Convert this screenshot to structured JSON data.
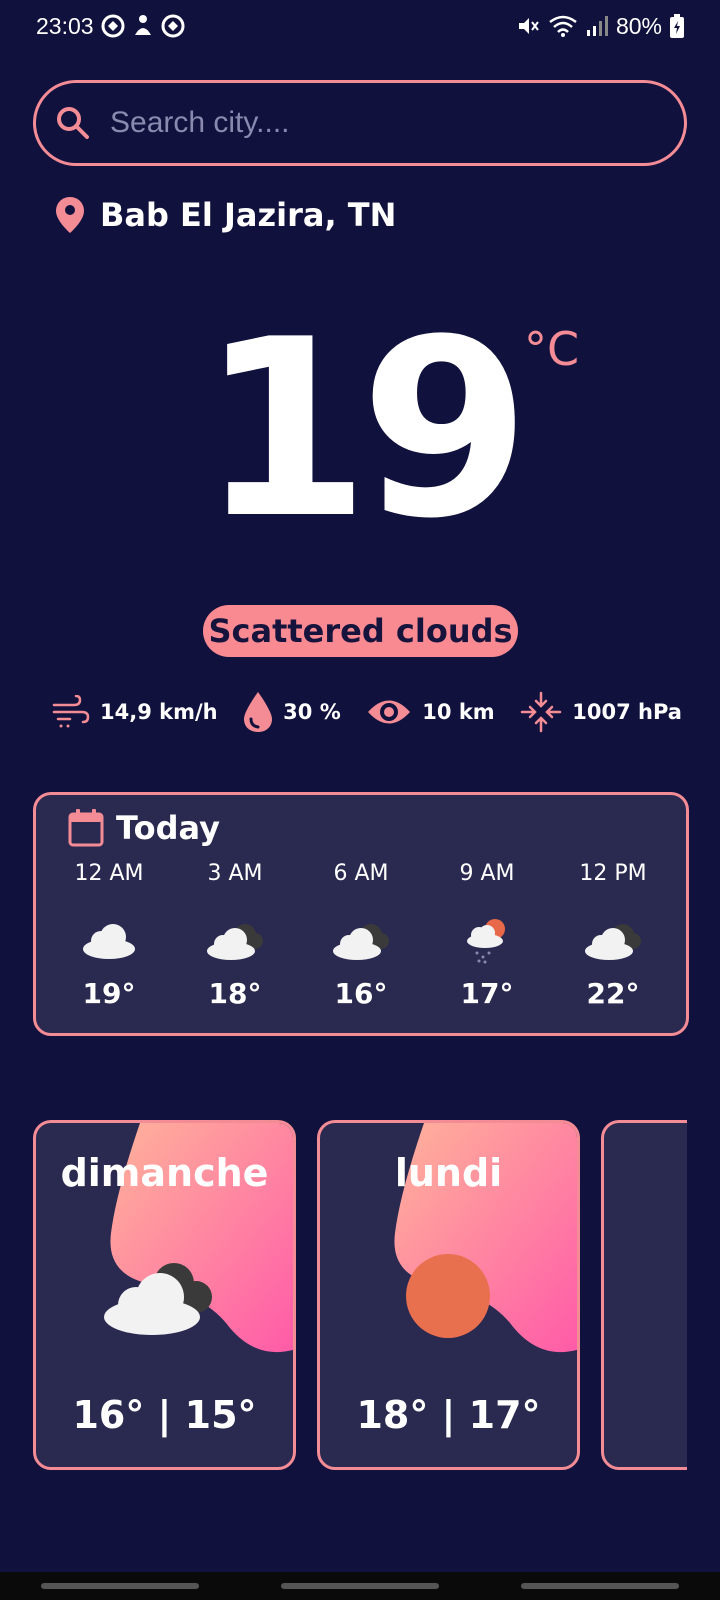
{
  "status_bar": {
    "time": "23:03",
    "battery": "80%",
    "left_icons": [
      "gear-like-icon",
      "notification-icon",
      "gear-like-icon"
    ],
    "right_icons": [
      "mute-icon",
      "wifi-icon",
      "signal-icon",
      "battery-icon"
    ]
  },
  "search": {
    "placeholder": "Search city....",
    "value": ""
  },
  "location": {
    "name": "Bab El Jazira, TN"
  },
  "current": {
    "temperature": "19",
    "unit": "°C",
    "condition": "Scattered clouds"
  },
  "metrics": [
    {
      "icon": "wind-icon",
      "value": "14,9 km/h"
    },
    {
      "icon": "humidity-drop-icon",
      "value": "30 %"
    },
    {
      "icon": "visibility-eye-icon",
      "value": "10 km"
    },
    {
      "icon": "pressure-icon",
      "value": "1007 hPa"
    }
  ],
  "today": {
    "title": "Today",
    "hours": [
      {
        "time": "12 AM",
        "icon": "cloud-icon",
        "temp": "19°"
      },
      {
        "time": "3 AM",
        "icon": "broken-clouds-icon",
        "temp": "18°"
      },
      {
        "time": "6 AM",
        "icon": "broken-clouds-icon",
        "temp": "16°"
      },
      {
        "time": "9 AM",
        "icon": "rain-sun-icon",
        "temp": "17°"
      },
      {
        "time": "12 PM",
        "icon": "broken-clouds-icon",
        "temp": "22°"
      }
    ]
  },
  "days": [
    {
      "name": "dimanche",
      "icon": "broken-clouds-icon",
      "range": "16° | 15°"
    },
    {
      "name": "lundi",
      "icon": "sun-icon",
      "range": "18° | 17°"
    }
  ],
  "colors": {
    "background": "#11113d",
    "accent": "#f48c96",
    "card": "#2a2950",
    "pill": "#fa8a92"
  }
}
